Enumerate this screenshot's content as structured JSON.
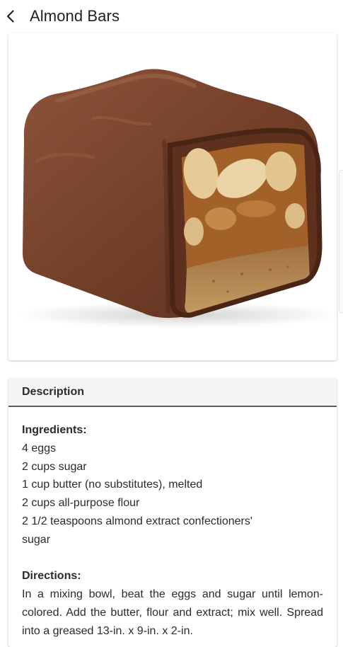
{
  "header": {
    "title": "Almond Bars",
    "back_icon": "chevron-left-icon"
  },
  "image": {
    "subject": "chocolate almond bar photo"
  },
  "description": {
    "header": "Description",
    "ingredients_heading": "Ingredients:",
    "ingredients": [
      "4 eggs",
      "2 cups sugar",
      "1 cup butter (no substitutes), melted",
      "2 cups all-purpose flour",
      "2 1/2 teaspoons almond extract  confectioners'",
      "sugar"
    ],
    "directions_heading": "Directions:",
    "directions": "In a mixing bowl, beat the eggs and sugar until lemon-colored. Add the butter, flour and extract; mix well. Spread into a greased 13-in. x 9-in. x 2-in."
  },
  "colors": {
    "chocolate": "#6b3a26",
    "chocolate_highlight": "#8a5238",
    "caramel": "#a8662a",
    "almond": "#e9cf9f",
    "cookie": "#b98a52",
    "header_underline": "#5c5c5c"
  }
}
